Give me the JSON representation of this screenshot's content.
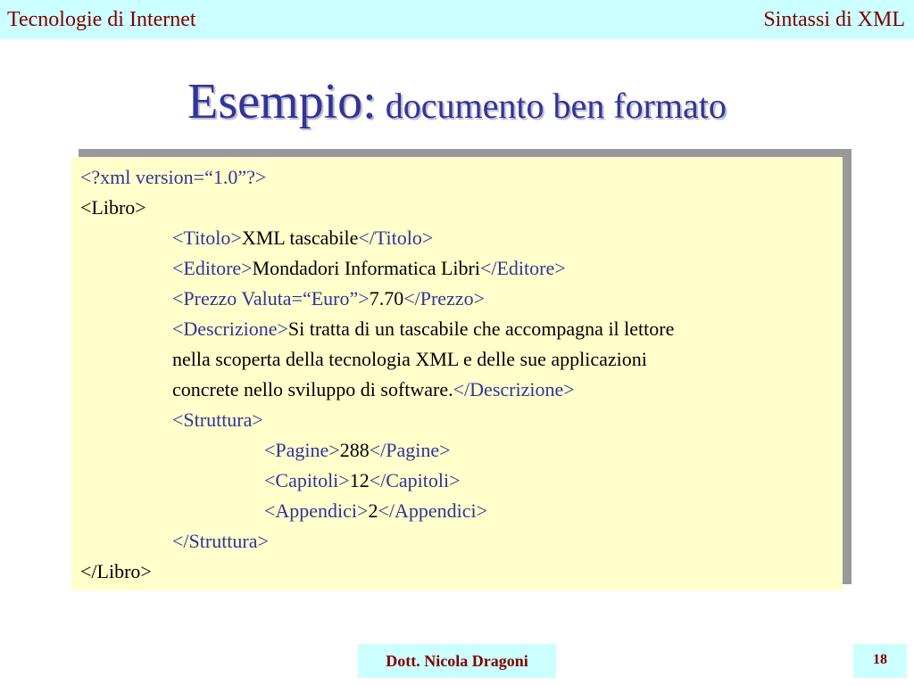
{
  "header": {
    "left": "Tecnologie di Internet",
    "right": "Sintassi di XML"
  },
  "title": {
    "main": "Esempio:",
    "sub": "documento ben formato"
  },
  "code": {
    "line1": "<?xml version=“1.0”?>",
    "libro_open": "<Libro>",
    "titolo_open": "<Titolo>",
    "titolo_value": "XML tascabile",
    "titolo_close": "</Titolo>",
    "editore_open": "<Editore>",
    "editore_value": "Mondadori Informatica Libri",
    "editore_close": "</Editore>",
    "prezzo_open": "<Prezzo Valuta=“Euro”>",
    "prezzo_value": "7.70",
    "prezzo_close": "</Prezzo>",
    "descrizione_open": "<Descrizione>",
    "descrizione_value_line1": "Si tratta di un tascabile che accompagna il lettore",
    "descrizione_value_line2": "nella scoperta della tecnologia XML e delle sue applicazioni",
    "descrizione_value_line3": "concrete nello sviluppo di software.",
    "descrizione_close": "</Descrizione>",
    "struttura_open": "<Struttura>",
    "pagine_open": "<Pagine>",
    "pagine_value": "288",
    "pagine_close": "</Pagine>",
    "capitoli_open": "<Capitoli>",
    "capitoli_value": "12",
    "capitoli_close": "</Capitoli>",
    "appendici_open": "<Appendici>",
    "appendici_value": "2",
    "appendici_close": "</Appendici>",
    "struttura_close": "</Struttura>",
    "libro_close": "</Libro>"
  },
  "footer": {
    "author": "Dott. Nicola Dragoni",
    "page_number": "18"
  },
  "colors": {
    "header_background": "#ccffff",
    "header_text": "#800000",
    "title_text": "#333399",
    "code_background": "#ffffcc",
    "code_tag": "#333399",
    "code_text": "#000000"
  }
}
